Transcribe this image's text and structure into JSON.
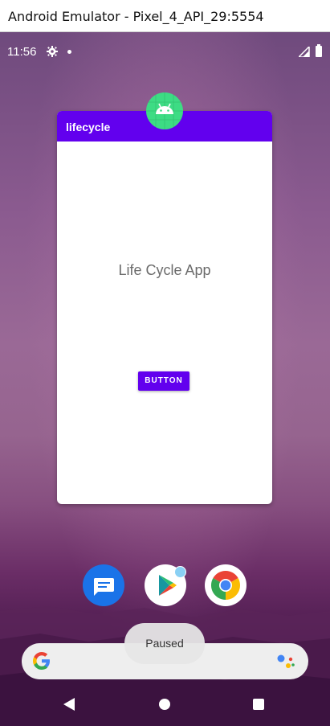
{
  "window": {
    "title": "Android Emulator - Pixel_4_API_29:5554"
  },
  "status_bar": {
    "time": "11:56",
    "icons": [
      "settings-gear-icon",
      "notification-dot-icon",
      "signal-icon",
      "battery-icon"
    ]
  },
  "recent_app": {
    "app_bar_title": "lifecycle",
    "body_text": "Life Cycle App",
    "button_label": "BUTTON",
    "accent_color": "#6200ee",
    "badge_icon": "android-robot-icon"
  },
  "dock": {
    "apps": [
      "Messages",
      "Play Store",
      "Chrome"
    ]
  },
  "search": {
    "logo": "google-g-icon",
    "assistant": "google-assistant-icon"
  },
  "toast": {
    "text": "Paused"
  },
  "nav": {
    "items": [
      "back",
      "home",
      "recents"
    ]
  }
}
